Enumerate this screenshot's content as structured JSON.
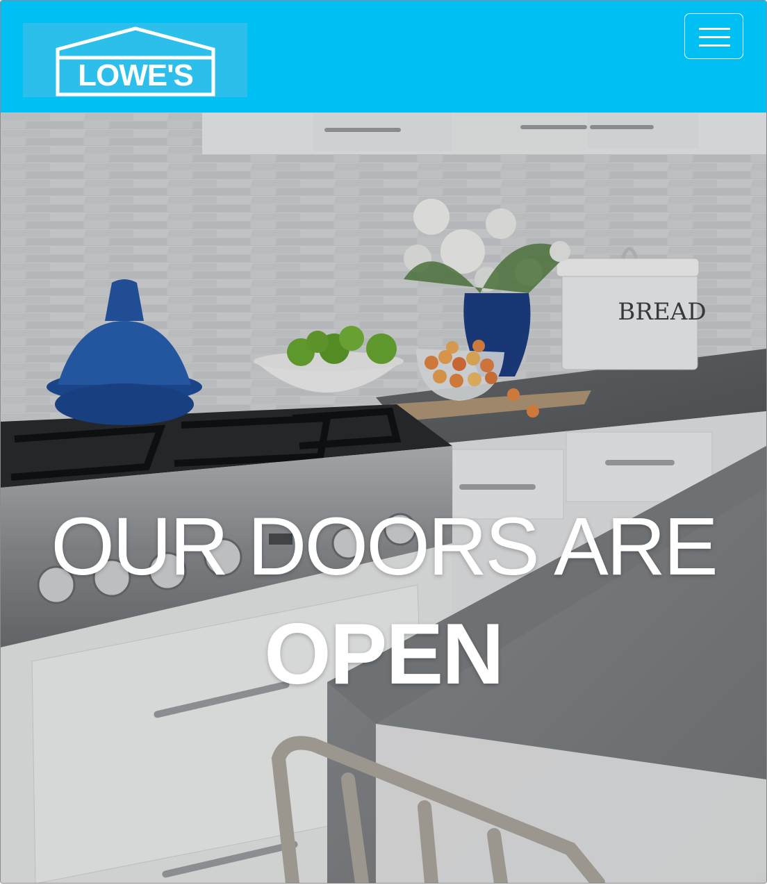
{
  "header": {
    "logo_text": "LOWE'S",
    "menu_icon": "hamburger-menu-icon",
    "background_color": "#00bff3"
  },
  "hero": {
    "title_line1": "OUR DOORS ARE",
    "title_line2": "OPEN",
    "canister_label": "BREAD"
  }
}
